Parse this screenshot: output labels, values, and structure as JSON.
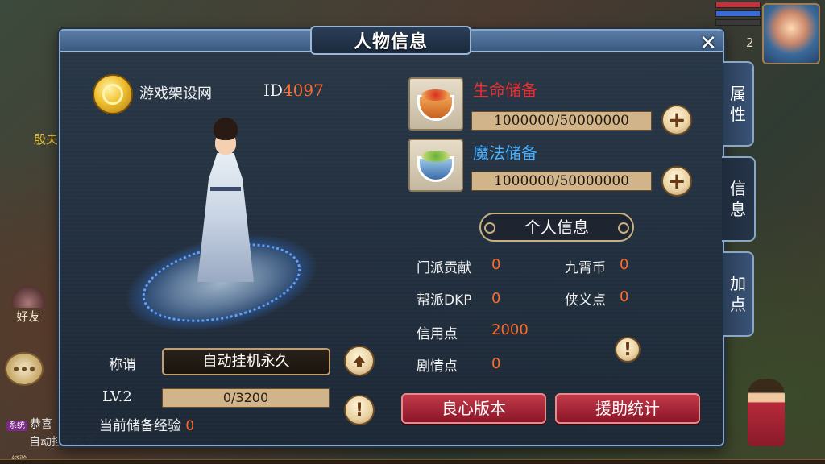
{
  "scene": {
    "npc_name": "殷夫",
    "friend_label": "好友",
    "chat_tag": "系统",
    "chat_line1": "恭喜",
    "chat_line2": "自动挂机永久...",
    "exp_label": "经验",
    "top_level": "2"
  },
  "panel": {
    "title": "人物信息",
    "close_label": "✕"
  },
  "player": {
    "name": "游戏架设网",
    "id_prefix": "ID",
    "id_value": "4097",
    "title_label": "称谓",
    "title_value": "自动挂机永久",
    "level": "LV.2",
    "exp": "0/3200",
    "exp_fraction": 0,
    "stored_exp_label": "当前储备经验",
    "stored_exp_value": "0"
  },
  "reserves": {
    "hp": {
      "label": "生命储备",
      "value": "1000000/50000000",
      "color": "#e83030"
    },
    "mp": {
      "label": "魔法储备",
      "value": "1000000/50000000",
      "color": "#4ab0ff"
    }
  },
  "personal": {
    "header": "个人信息",
    "stats": [
      {
        "label": "门派贡献",
        "value": "0"
      },
      {
        "label": "九霄币",
        "value": "0"
      },
      {
        "label": "帮派DKP",
        "value": "0"
      },
      {
        "label": "侠义点",
        "value": "0"
      },
      {
        "label": "信用点",
        "value": "2000"
      },
      {
        "label": "剧情点",
        "value": "0"
      }
    ]
  },
  "buttons": {
    "conscience": "良心版本",
    "aid_stats": "援助统计"
  },
  "tabs": [
    {
      "label": "属\n性",
      "active": false
    },
    {
      "label": "信\n息",
      "active": true
    },
    {
      "label": "加\n点",
      "active": false
    }
  ],
  "colors": {
    "accent_orange": "#ff6a2a",
    "panel_border": "#8aa7c7"
  }
}
